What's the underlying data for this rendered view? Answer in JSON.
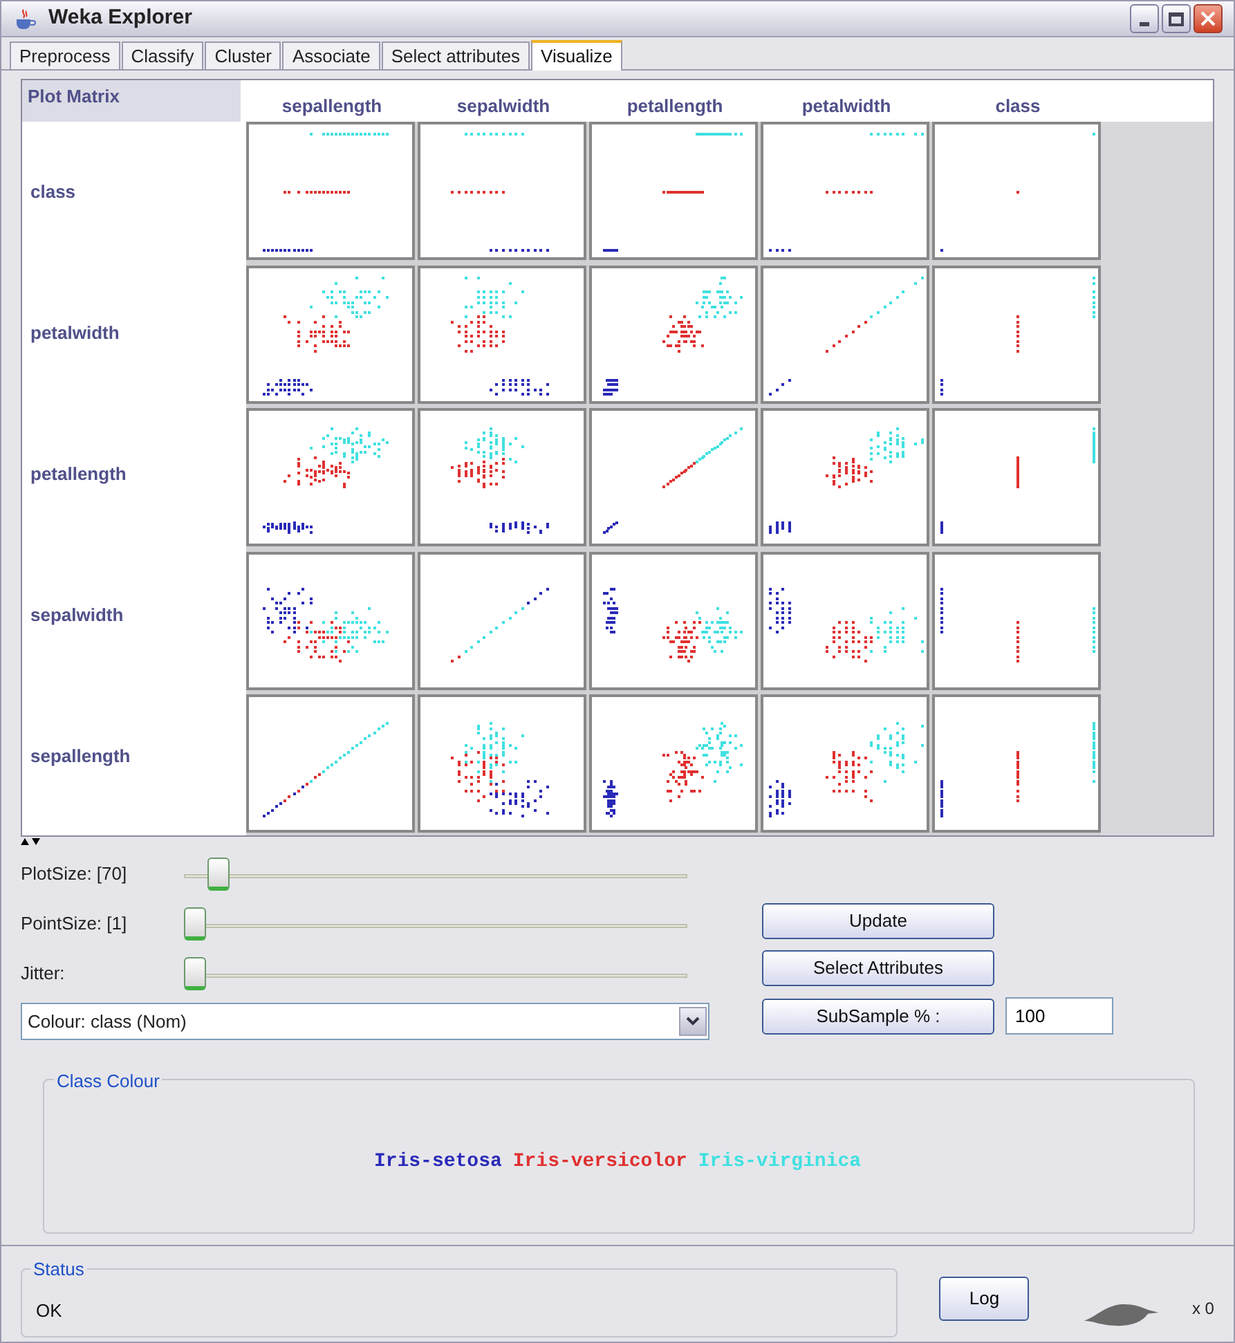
{
  "window": {
    "title": "Weka Explorer"
  },
  "tabs": [
    {
      "label": "Preprocess",
      "selected": false
    },
    {
      "label": "Classify",
      "selected": false
    },
    {
      "label": "Cluster",
      "selected": false
    },
    {
      "label": "Associate",
      "selected": false
    },
    {
      "label": "Select attributes",
      "selected": false
    },
    {
      "label": "Visualize",
      "selected": true
    }
  ],
  "plot_matrix": {
    "title": "Plot Matrix",
    "columns": [
      "sepallength",
      "sepalwidth",
      "petallength",
      "petalwidth",
      "class"
    ],
    "rows": [
      "class",
      "petalwidth",
      "petallength",
      "sepalwidth",
      "sepallength"
    ]
  },
  "sliders": [
    {
      "label": "PlotSize: [70]",
      "level": 0.05
    },
    {
      "label": "PointSize: [1]",
      "level": 0
    },
    {
      "label": "Jitter:",
      "level": 0
    }
  ],
  "colour_select": {
    "value": "Colour: class  (Nom)"
  },
  "buttons": {
    "update": "Update",
    "select_attributes": "Select Attributes",
    "subsample": "SubSample % :"
  },
  "subsample_value": "100",
  "class_colour": {
    "title": "Class Colour",
    "classes": [
      {
        "name": "Iris-setosa",
        "color": "#2a2ab8"
      },
      {
        "name": "Iris-versicolor",
        "color": "#e03030"
      },
      {
        "name": "Iris-virginica",
        "color": "#40e0e0"
      }
    ]
  },
  "status": {
    "title": "Status",
    "message": "OK"
  },
  "log_button": "Log",
  "task_count": "x 0"
}
